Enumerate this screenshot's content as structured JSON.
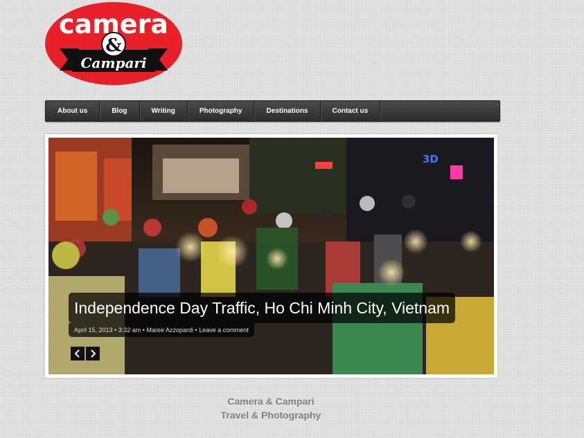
{
  "logo": {
    "top_text": "camera",
    "ampersand": "&",
    "banner_text": "Campari"
  },
  "nav": {
    "items": [
      {
        "label": "About us"
      },
      {
        "label": "Blog"
      },
      {
        "label": "Writing"
      },
      {
        "label": "Photography"
      },
      {
        "label": "Destinations"
      },
      {
        "label": "Contact us"
      }
    ]
  },
  "slider": {
    "title": "Independence Day Traffic, Ho Chi Minh City, Vietnam",
    "meta": {
      "date": "April 15, 2013",
      "sep1": "•",
      "time": "3:32 am",
      "sep2": "•",
      "author": "Maree Azzopardi",
      "sep3": "•",
      "comment_link": "Leave a comment"
    },
    "prev_icon": "chevron-left-icon",
    "next_icon": "chevron-right-icon",
    "photo_sign": "3D"
  },
  "footer": {
    "line1": "Camera & Campari",
    "line2": "Travel & Photography"
  },
  "colors": {
    "logo_red": "#e8202a",
    "nav_dark": "#3a3a3a",
    "footer_text": "#7d7d7d"
  }
}
